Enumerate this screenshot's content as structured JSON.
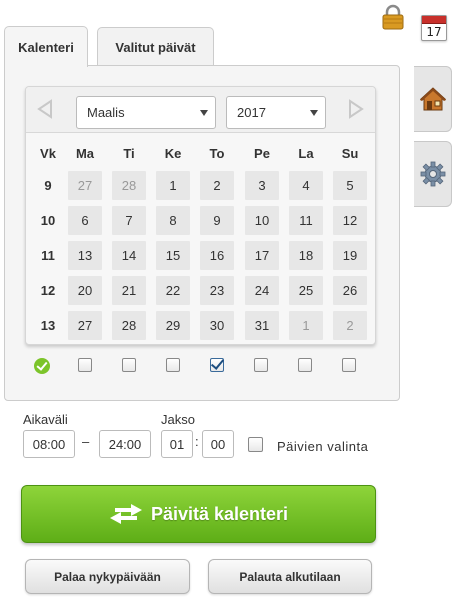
{
  "tabs": [
    {
      "label": "Kalenteri",
      "active": true
    },
    {
      "label": "Valitut päivät",
      "active": false
    }
  ],
  "top_icons": {
    "calendar_day": "17"
  },
  "calendar": {
    "month": "Maalis",
    "year": "2017",
    "headers": [
      "Vk",
      "Ma",
      "Ti",
      "Ke",
      "To",
      "Pe",
      "La",
      "Su"
    ],
    "weeks": [
      {
        "wk": "9",
        "days": [
          {
            "d": "27",
            "other": true
          },
          {
            "d": "28",
            "other": true
          },
          {
            "d": "1"
          },
          {
            "d": "2"
          },
          {
            "d": "3"
          },
          {
            "d": "4"
          },
          {
            "d": "5"
          }
        ]
      },
      {
        "wk": "10",
        "days": [
          {
            "d": "6"
          },
          {
            "d": "7"
          },
          {
            "d": "8"
          },
          {
            "d": "9"
          },
          {
            "d": "10"
          },
          {
            "d": "11"
          },
          {
            "d": "12"
          }
        ]
      },
      {
        "wk": "11",
        "days": [
          {
            "d": "13"
          },
          {
            "d": "14"
          },
          {
            "d": "15"
          },
          {
            "d": "16"
          },
          {
            "d": "17"
          },
          {
            "d": "18"
          },
          {
            "d": "19"
          }
        ]
      },
      {
        "wk": "12",
        "days": [
          {
            "d": "20"
          },
          {
            "d": "21"
          },
          {
            "d": "22"
          },
          {
            "d": "23"
          },
          {
            "d": "24"
          },
          {
            "d": "25"
          },
          {
            "d": "26"
          }
        ]
      },
      {
        "wk": "13",
        "days": [
          {
            "d": "27"
          },
          {
            "d": "28"
          },
          {
            "d": "29"
          },
          {
            "d": "30"
          },
          {
            "d": "31"
          },
          {
            "d": "1",
            "other": true
          },
          {
            "d": "2",
            "other": true
          }
        ]
      }
    ],
    "weekday_checks": [
      false,
      false,
      false,
      true,
      false,
      false,
      false
    ]
  },
  "time": {
    "aikavali_label": "Aikaväli",
    "start": "08:00",
    "end": "24:00",
    "jakso_label": "Jakso",
    "jakso_h": "01",
    "jakso_m": "00",
    "paivien_valinta_label": "Päivien valinta"
  },
  "buttons": {
    "update": "Päivitä kalenteri",
    "today": "Palaa nykypäivään",
    "reset": "Palauta alkutilaan"
  },
  "colors": {
    "accent_green": "#6cbc22",
    "checked_blue": "#1d4e80"
  }
}
